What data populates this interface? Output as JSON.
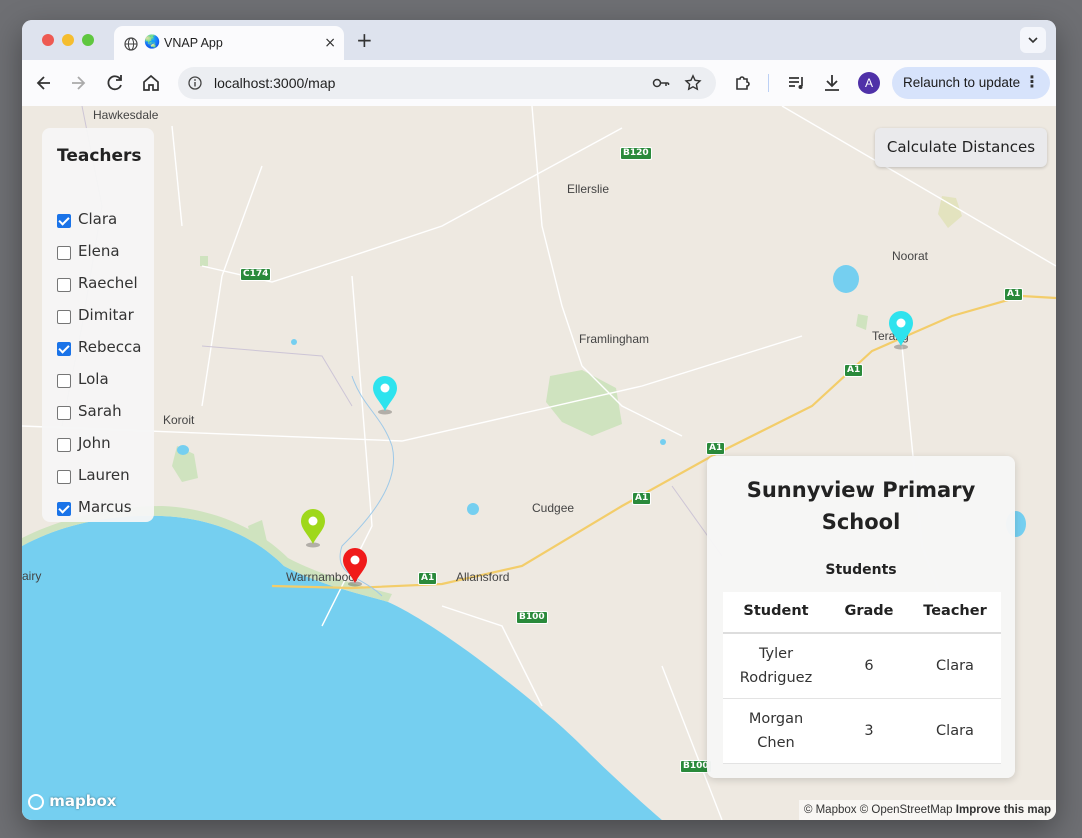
{
  "browser": {
    "tab_title": "VNAP App",
    "tab_favicon": "🌏",
    "url": "localhost:3000/map",
    "relaunch_label": "Relaunch to update",
    "avatar_letter": "A",
    "new_tab": "+",
    "close": "×"
  },
  "map": {
    "places": [
      {
        "name": "Hawkesdale"
      },
      {
        "name": "Ellerslie"
      },
      {
        "name": "Noorat"
      },
      {
        "name": "Framlingham"
      },
      {
        "name": "Koroit"
      },
      {
        "name": "Cudgee"
      },
      {
        "name": "Warrnambool"
      },
      {
        "name": "Allansford"
      },
      {
        "name": "airy"
      },
      {
        "name": "Terang"
      }
    ],
    "road_shields": [
      "B120",
      "C174",
      "A1",
      "A1",
      "A1",
      "A1",
      "A1",
      "B100",
      "B100"
    ],
    "attribution": "© Mapbox © OpenStreetMap",
    "improve_link": "Improve this map",
    "logo": "mapbox",
    "colors": {
      "land": "#eee9e1",
      "water": "#75cff0",
      "park": "#cfe3bf",
      "road_major": "#f3cd6a"
    }
  },
  "teachers_panel": {
    "title": "Teachers",
    "items": [
      {
        "name": "Clara",
        "checked": true
      },
      {
        "name": "Elena",
        "checked": false
      },
      {
        "name": "Raechel",
        "checked": false
      },
      {
        "name": "Dimitar",
        "checked": false
      },
      {
        "name": "Rebecca",
        "checked": true
      },
      {
        "name": "Lola",
        "checked": false
      },
      {
        "name": "Sarah",
        "checked": false
      },
      {
        "name": "John",
        "checked": false
      },
      {
        "name": "Lauren",
        "checked": false
      },
      {
        "name": "Marcus",
        "checked": true
      }
    ]
  },
  "calculate_button": "Calculate Distances",
  "pins": [
    {
      "color": "#2ee3ee",
      "label": "cyan"
    },
    {
      "color": "#2ee3ee",
      "label": "cyan"
    },
    {
      "color": "#9fd81a",
      "label": "lime"
    },
    {
      "color": "#f01a1a",
      "label": "red"
    }
  ],
  "school_card": {
    "title": "Sunnyview Primary School",
    "subtitle": "Students",
    "headers": [
      "Student",
      "Grade",
      "Teacher"
    ],
    "rows": [
      {
        "student": "Tyler Rodriguez",
        "grade": "6",
        "teacher": "Clara"
      },
      {
        "student": "Morgan Chen",
        "grade": "3",
        "teacher": "Clara"
      }
    ]
  }
}
